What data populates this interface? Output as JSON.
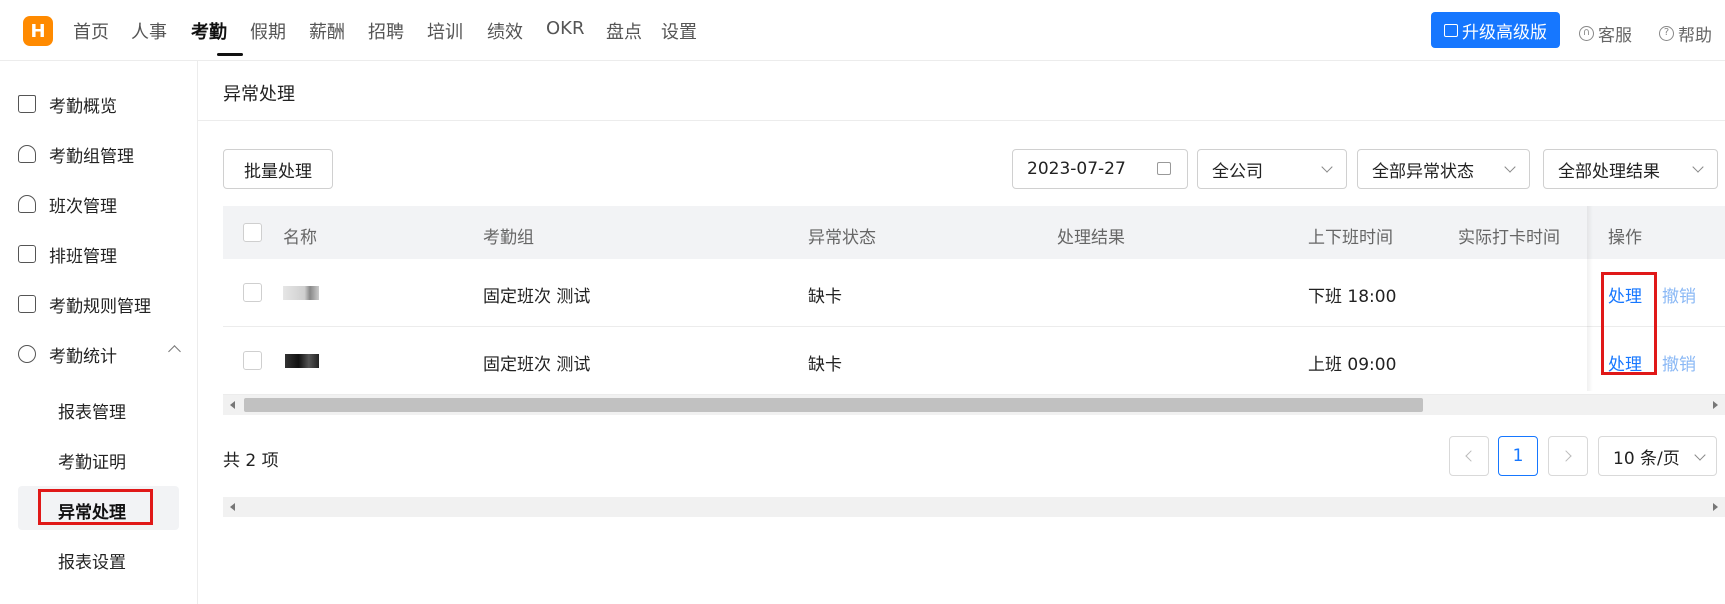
{
  "app": {
    "logo_letter": "H"
  },
  "nav": {
    "items": [
      "首页",
      "人事",
      "考勤",
      "假期",
      "薪酬",
      "招聘",
      "培训",
      "绩效",
      "OKR",
      "盘点",
      "设置"
    ],
    "active_index": 2,
    "upgrade_label": "升级高级版",
    "service_label": "客服",
    "help_label": "帮助"
  },
  "sidebar": {
    "items": [
      "考勤概览",
      "考勤组管理",
      "班次管理",
      "排班管理",
      "考勤规则管理",
      "考勤统计"
    ],
    "sub_items": [
      "报表管理",
      "考勤证明",
      "异常处理",
      "报表设置"
    ],
    "active_sub_index": 2
  },
  "page": {
    "title": "异常处理"
  },
  "toolbar": {
    "batch_label": "批量处理",
    "date_value": "2023-07-27",
    "company_value": "全公司",
    "status_value": "全部异常状态",
    "result_value": "全部处理结果"
  },
  "table": {
    "columns": [
      "名称",
      "考勤组",
      "异常状态",
      "处理结果",
      "上下班时间",
      "实际打卡时间",
      "操作"
    ],
    "rows": [
      {
        "name": "",
        "group": "固定班次 测试",
        "status": "缺卡",
        "result": "",
        "shift_time": "下班 18:00",
        "actual_time": "",
        "action_primary": "处理",
        "action_secondary": "撤销"
      },
      {
        "name": "",
        "group": "固定班次 测试",
        "status": "缺卡",
        "result": "",
        "shift_time": "上班 09:00",
        "actual_time": "",
        "action_primary": "处理",
        "action_secondary": "撤销"
      }
    ]
  },
  "pagination": {
    "total_label": "共 2 项",
    "current_page": "1",
    "page_size_label": "10 条/页"
  },
  "colors": {
    "accent": "#1677ff",
    "logo": "#ff8a00",
    "highlight": "#e01818"
  }
}
